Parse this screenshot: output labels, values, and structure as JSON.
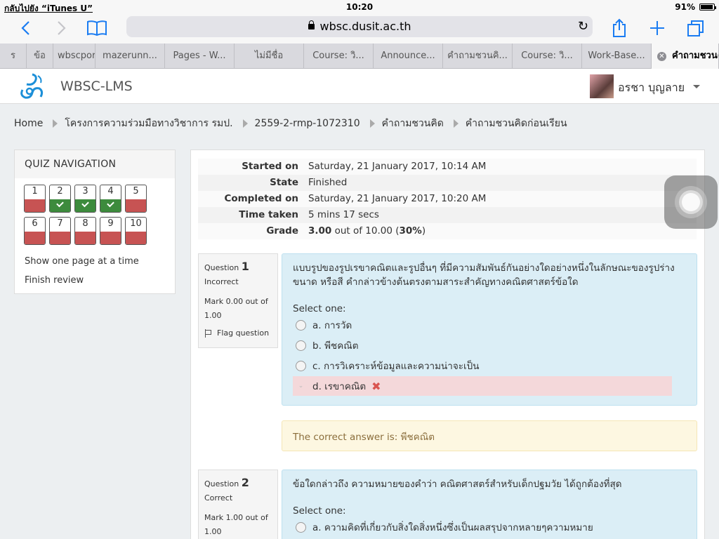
{
  "status_bar": {
    "back_app": "กลับไปยัง “iTunes U”",
    "time": "10:20",
    "battery": "91%"
  },
  "browser": {
    "url": "wbsc.dusit.ac.th",
    "tabs": [
      {
        "label": "ร"
      },
      {
        "label": "ข้อ"
      },
      {
        "label": "wbscpor"
      },
      {
        "label": "mazerunn..."
      },
      {
        "label": "Pages - W..."
      },
      {
        "label": "ไม่มีชื่อ"
      },
      {
        "label": "Course: วิ..."
      },
      {
        "label": "Announce..."
      },
      {
        "label": "คำถามชวนคิ..."
      },
      {
        "label": "Course: วิ..."
      },
      {
        "label": "Work-Base..."
      },
      {
        "label": "คำถามชวนคิ..."
      }
    ]
  },
  "header": {
    "site_name": "WBSC-LMS",
    "user_name": "อรชา บุญลาย"
  },
  "breadcrumb": [
    "Home",
    "โครงการความร่วมมือทางวิชาการ รมป.",
    "2559-2-rmp-1072310",
    "คำถามชวนคิด",
    "คำถามชวนคิดก่อนเรียน"
  ],
  "quiz_nav": {
    "title": "QUIZ NAVIGATION",
    "questions": [
      {
        "num": "1",
        "state": "wrong"
      },
      {
        "num": "2",
        "state": "right"
      },
      {
        "num": "3",
        "state": "right"
      },
      {
        "num": "4",
        "state": "right"
      },
      {
        "num": "5",
        "state": "wrong"
      },
      {
        "num": "6",
        "state": "wrong"
      },
      {
        "num": "7",
        "state": "wrong"
      },
      {
        "num": "8",
        "state": "wrong"
      },
      {
        "num": "9",
        "state": "wrong"
      },
      {
        "num": "10",
        "state": "wrong"
      }
    ],
    "show_one_page": "Show one page at a time",
    "finish_review": "Finish review"
  },
  "summary": {
    "started_label": "Started on",
    "started_value": "Saturday, 21 January 2017, 10:14 AM",
    "state_label": "State",
    "state_value": "Finished",
    "completed_label": "Completed on",
    "completed_value": "Saturday, 21 January 2017, 10:20 AM",
    "time_label": "Time taken",
    "time_value": "5 mins 17 secs",
    "grade_label": "Grade",
    "grade_score": "3.00",
    "grade_out_of": " out of 10.00 (",
    "grade_percent": "30%",
    "grade_close": ")"
  },
  "question1": {
    "label": "Question",
    "number": "1",
    "status": "Incorrect",
    "mark": "Mark 0.00 out of 1.00",
    "flag": "Flag question",
    "text": "แบบรูปของรูปเรขาคณิตและรูปอื่นๆ ที่มีความสัมพันธ์กันอย่างใดอย่างหนึ่งในลักษณะของรูปร่าง ขนาด หรือสี คำกล่าวข้างต้นตรงตามสาระสำคัญทางคณิตศาสตร์ข้อใด",
    "select_one": "Select one:",
    "answers": [
      "a. การวัด",
      "b. พีชคณิต",
      "c. การวิเคราะห์ข้อมูลและความน่าจะเป็น",
      "d. เรขาคณิต"
    ],
    "correct_answer": "The correct answer is: พีชคณิต"
  },
  "question2": {
    "label": "Question",
    "number": "2",
    "status": "Correct",
    "mark": "Mark 1.00 out of 1.00",
    "text": "ข้อใดกล่าวถึง ความหมายของคำว่า คณิตศาสตร์สำหรับเด็กปฐมวัย ได้ถูกต้องที่สุด",
    "select_one": "Select one:",
    "answers": [
      "a. ความคิดที่เกี่ยวกับสิ่งใดสิ่งหนึ่งซึ่งเป็นผลสรุปจากหลายๆความหมาย"
    ]
  },
  "colors": {
    "incorrect": "#c75353",
    "correct": "#3d8b3d",
    "question_bg": "#dbeef6",
    "feedback_bg": "#fdf7e1"
  }
}
